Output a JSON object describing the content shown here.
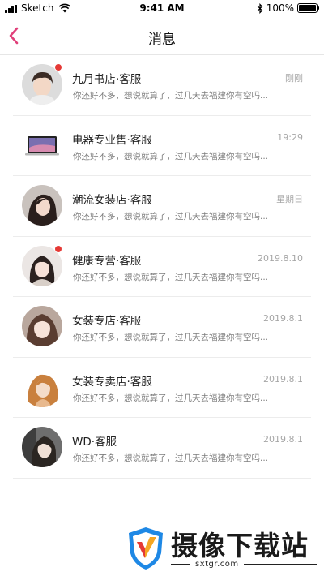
{
  "status_bar": {
    "carrier": "Sketch",
    "time": "9:41 AM",
    "battery": "100%"
  },
  "nav": {
    "title": "消息"
  },
  "messages": [
    {
      "name": "九月书店·客服",
      "time": "刚刚",
      "preview": "你还好不多，想说就算了，过几天去福建你有空吗...",
      "unread": true,
      "avatar": "avatar-boy"
    },
    {
      "name": "电器专业售·客服",
      "time": "19:29",
      "preview": "你还好不多，想说就算了，过几天去福建你有空吗...",
      "unread": false,
      "avatar": "avatar-laptop"
    },
    {
      "name": "潮流女装店·客服",
      "time": "星期日",
      "preview": "你还好不多，想说就算了，过几天去福建你有空吗...",
      "unread": false,
      "avatar": "avatar-girl"
    },
    {
      "name": "健康专营·客服",
      "time": "2019.8.10",
      "preview": "你还好不多，想说就算了，过几天去福建你有空吗...",
      "unread": true,
      "avatar": "avatar-girl"
    },
    {
      "name": "女装专店·客服",
      "time": "2019.8.1",
      "preview": "你还好不多，想说就算了，过几天去福建你有空吗...",
      "unread": false,
      "avatar": "avatar-girl"
    },
    {
      "name": "女装专卖店·客服",
      "time": "2019.8.1",
      "preview": "你还好不多，想说就算了，过几天去福建你有空吗...",
      "unread": false,
      "avatar": "avatar-girl-blonde"
    },
    {
      "name": "WD·客服",
      "time": "2019.8.1",
      "preview": "你还好不多，想说就算了，过几天去福建你有空吗...",
      "unread": false,
      "avatar": "avatar-girl"
    }
  ],
  "watermark": {
    "text": "摄像下载站",
    "url": "sxtgr.com"
  },
  "colors": {
    "accent": "#e0407a",
    "unread_dot": "#e53935"
  }
}
